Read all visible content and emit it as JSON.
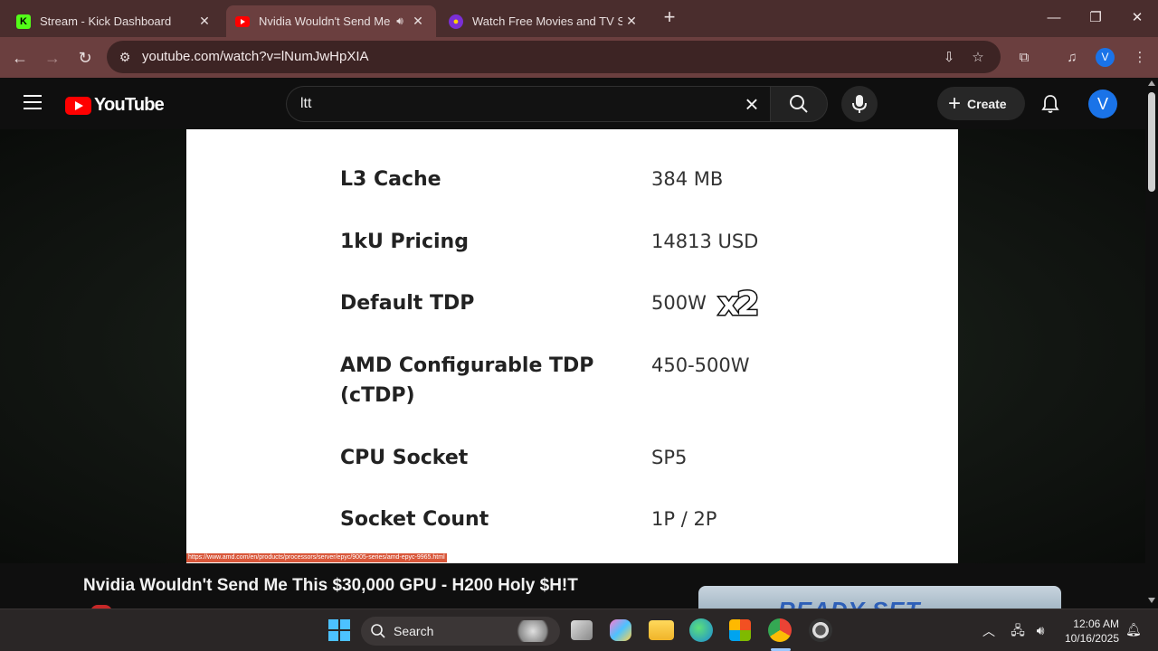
{
  "browser": {
    "tabs": [
      {
        "title": "Stream - Kick Dashboard",
        "favicon": "kick-icon",
        "active": false
      },
      {
        "title": "Nvidia Wouldn't Send Me Thi",
        "favicon": "youtube-icon",
        "active": true,
        "audio": true
      },
      {
        "title": "Watch Free Movies and TV Sho",
        "favicon": "movie-site-icon",
        "active": false
      }
    ],
    "url": "youtube.com/watch?v=lNumJwHpXIA",
    "profile_initial": "V"
  },
  "youtube": {
    "logo_text": "YouTube",
    "search_query": "ltt",
    "create_label": "Create",
    "avatar_initial": "V"
  },
  "video": {
    "slide_specs": [
      {
        "label": "L3 Cache",
        "value": "384 MB"
      },
      {
        "label": "1kU Pricing",
        "value": "14813 USD"
      },
      {
        "label": "Default TDP",
        "value": "500W"
      },
      {
        "label": "AMD Configurable TDP (cTDP)",
        "value": "450-500W"
      },
      {
        "label": "CPU Socket",
        "value": "SP5"
      },
      {
        "label": "Socket Count",
        "value": "1P / 2P"
      }
    ],
    "overlay_multiplier": "x2",
    "source_url": "https://www.amd.com/en/products/processors/server/epyc/9005-series/amd-epyc-9965.html",
    "title": "Nvidia Wouldn't Send Me This $30,000 GPU - H200 Holy $H!T",
    "ad_text": "READY SET"
  },
  "taskbar": {
    "search_label": "Search",
    "time": "12:06 AM",
    "date": "10/16/2025"
  }
}
